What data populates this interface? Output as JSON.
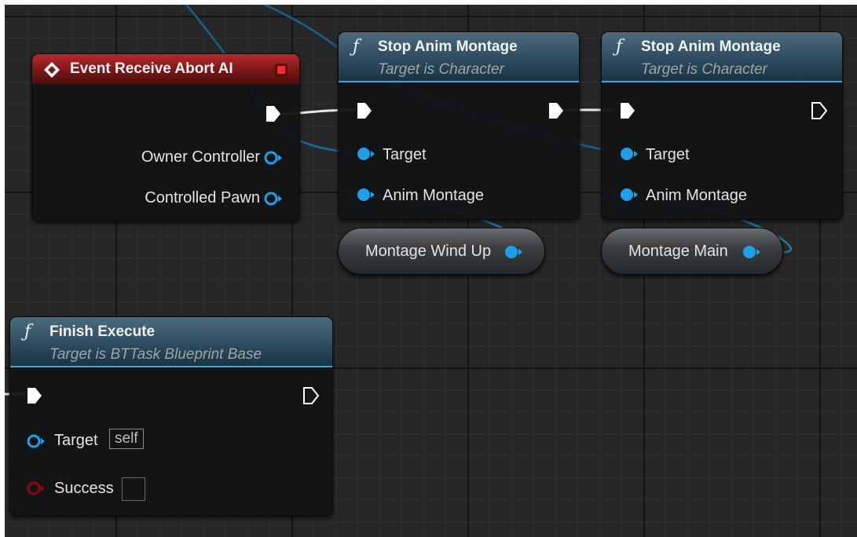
{
  "nodes": {
    "event_abort": {
      "title": "Event Receive Abort AI",
      "pins": {
        "owner_controller": "Owner Controller",
        "controlled_pawn": "Controlled Pawn"
      }
    },
    "stop_anim_1": {
      "title": "Stop Anim Montage",
      "subtitle": "Target is Character",
      "pins": {
        "target": "Target",
        "anim_montage": "Anim Montage"
      }
    },
    "stop_anim_2": {
      "title": "Stop Anim Montage",
      "subtitle": "Target is Character",
      "pins": {
        "target": "Target",
        "anim_montage": "Anim Montage"
      }
    },
    "montage_wind_up": {
      "label": "Montage Wind Up"
    },
    "montage_main": {
      "label": "Montage Main"
    },
    "finish_execute": {
      "title": "Finish Execute",
      "subtitle": "Target is BTTask Blueprint Base",
      "pins": {
        "target": "Target",
        "target_default": "self",
        "success": "Success"
      }
    }
  },
  "colors": {
    "object_pin": "#1ea0e8",
    "bool_pin": "#8c0a0a",
    "exec_pin": "#ffffff",
    "wire": "#1c6a9c",
    "event_header": "#a82020",
    "function_header": "#2d4b60"
  }
}
